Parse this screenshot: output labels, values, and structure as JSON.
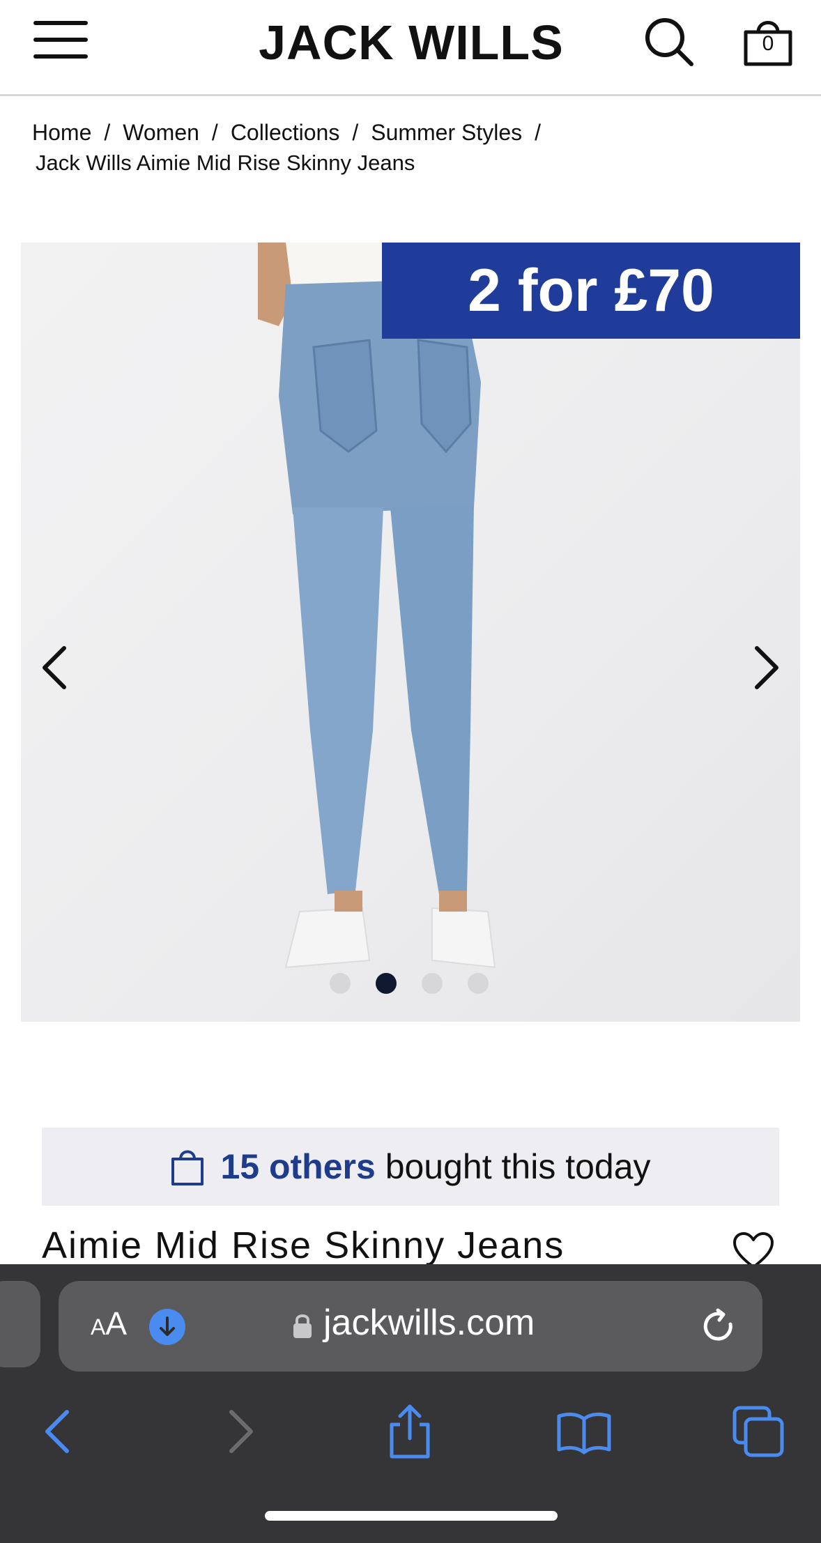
{
  "header": {
    "brand": "JACK WILLS",
    "bag_count": "0"
  },
  "breadcrumb": {
    "items": [
      "Home",
      "Women",
      "Collections",
      "Summer Styles"
    ],
    "separator": "/",
    "current": "Jack Wills Aimie Mid Rise Skinny Jeans"
  },
  "gallery": {
    "promo": "2 for £70",
    "dots_total": 4,
    "active_dot": 2
  },
  "social_proof": {
    "count": "15 others",
    "text": "bought this today"
  },
  "product": {
    "title": "Aimie Mid Rise Skinny Jeans"
  },
  "browser": {
    "aa_small": "A",
    "aa_large": "A",
    "url": "jackwills.com"
  },
  "colors": {
    "promo_bg": "#1f3c9a",
    "social_accent": "#1f3c8c",
    "browser_bg": "#353537",
    "browser_icon": "#4a8bf0"
  }
}
